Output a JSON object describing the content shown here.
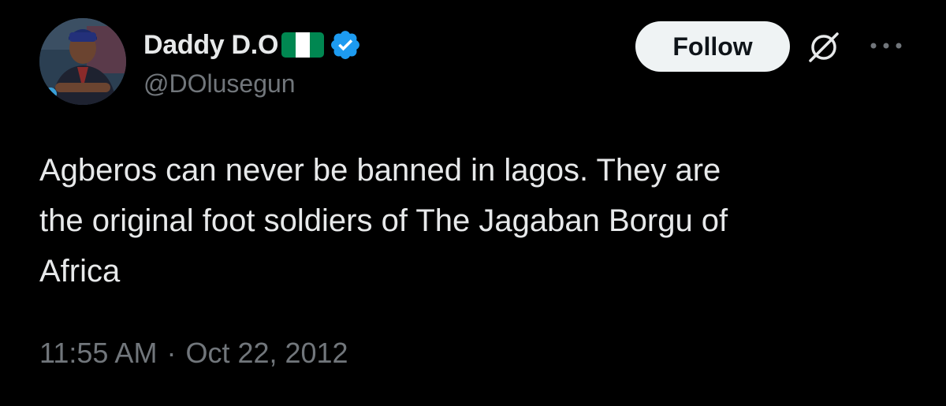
{
  "tweet": {
    "author": {
      "display_name": "Daddy D.O",
      "handle": "@DOlusegun",
      "flag_icon": "nigeria-flag-icon",
      "flag_colors": [
        "#008751",
        "#ffffff",
        "#008751"
      ],
      "verified_icon": "verified-badge-icon",
      "verified_color": "#1d9bf0"
    },
    "actions": {
      "follow_label": "Follow",
      "grok_icon": "grok-icon",
      "more_icon": "more-options-icon"
    },
    "text": "Agberos can never be banned in lagos. They are\nthe original foot soldiers of The Jagaban Borgu of\nAfrica",
    "time": "11:55 AM",
    "separator": "·",
    "date": "Oct 22, 2012"
  },
  "colors": {
    "background": "#000000",
    "primary_text": "#e7e9ea",
    "secondary_text": "#71767b",
    "follow_bg": "#eff3f4",
    "follow_text": "#0f1419"
  }
}
